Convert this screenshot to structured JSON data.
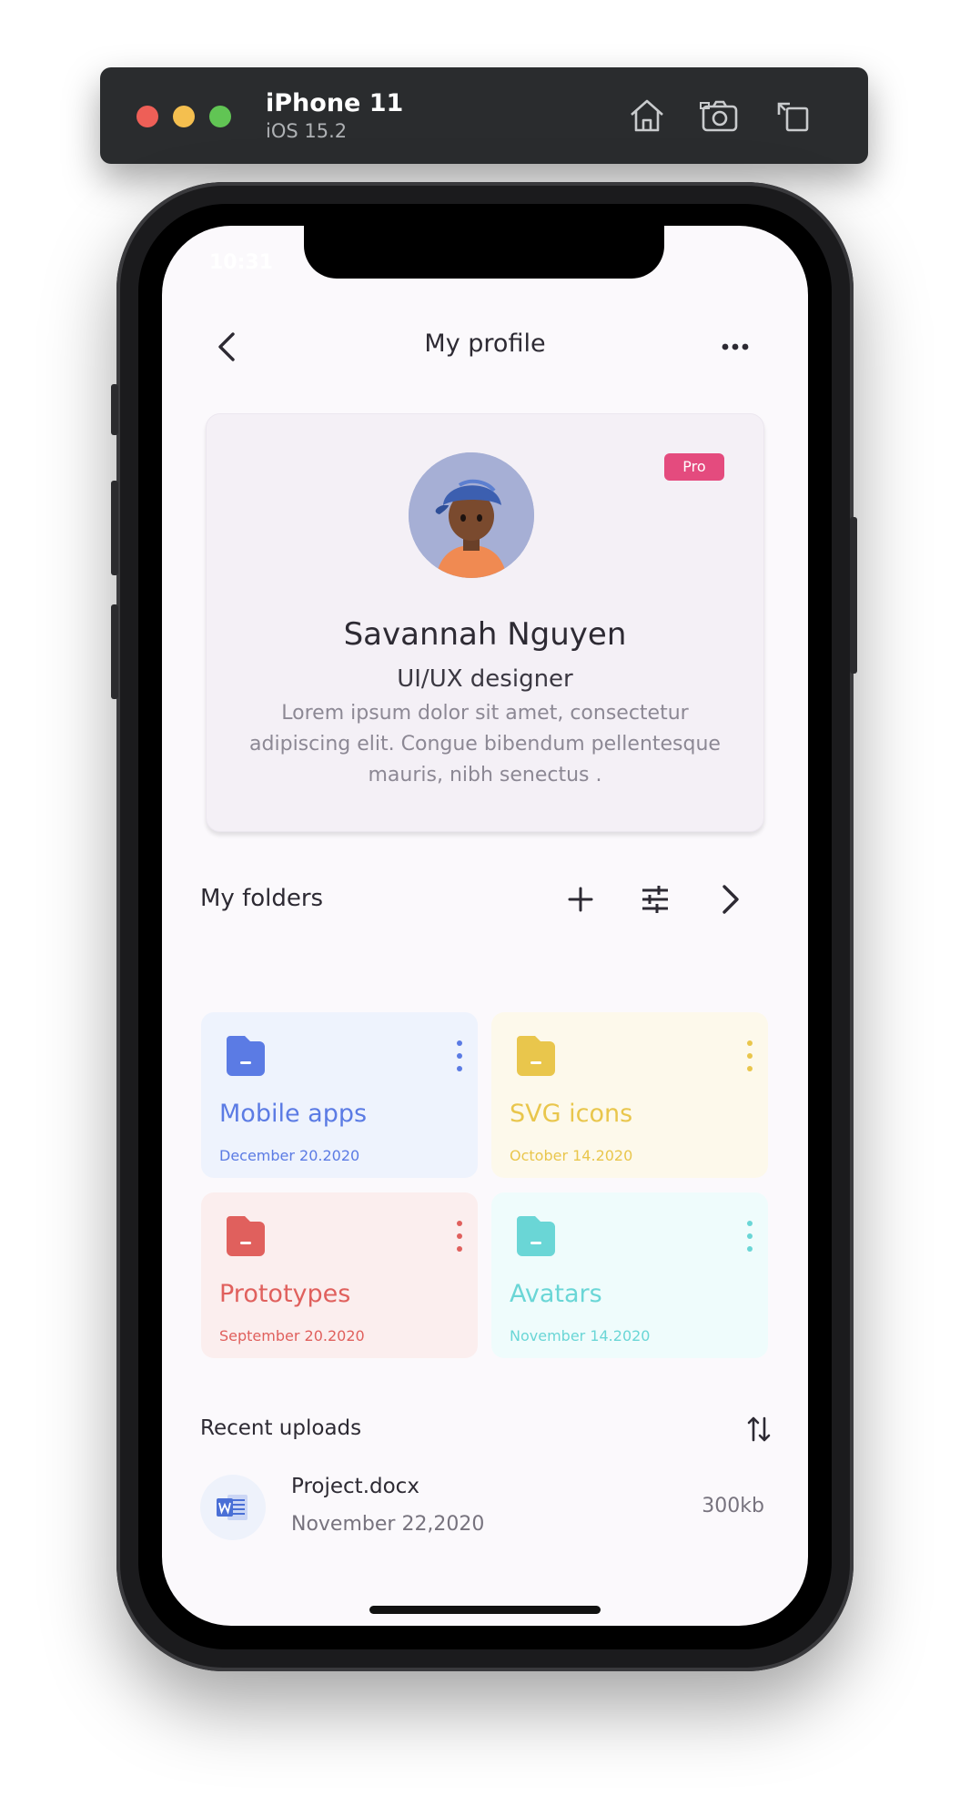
{
  "simulator": {
    "device_name": "iPhone 11",
    "os_version": "iOS 15.2",
    "buttons": {
      "home": "home-icon",
      "screenshot": "camera-icon",
      "rotate": "rotate-icon"
    }
  },
  "status_bar": {
    "time": "10:31"
  },
  "header": {
    "title": "My profile"
  },
  "profile": {
    "badge": "Pro",
    "name": "Savannah Nguyen",
    "role": "UI/UX designer",
    "bio": "Lorem ipsum dolor sit amet, consectetur adipiscing elit. Congue bibendum pellentesque mauris, nibh senectus ."
  },
  "folders_section": {
    "title": "My folders",
    "actions": [
      "plus-icon",
      "sliders-icon",
      "chevron-right-icon"
    ]
  },
  "folders": [
    {
      "name": "Mobile apps",
      "date": "December 20.2020",
      "color": "#5b7be4",
      "bg": "#eef3fd"
    },
    {
      "name": "SVG icons",
      "date": "October 14.2020",
      "color": "#e9c64c",
      "bg": "#fdf9eb"
    },
    {
      "name": "Prototypes",
      "date": "September 20.2020",
      "color": "#e0605d",
      "bg": "#fbeeee"
    },
    {
      "name": "Avatars",
      "date": "November 14.2020",
      "color": "#6ad6d6",
      "bg": "#effcfc"
    }
  ],
  "recent": {
    "title": "Recent uploads",
    "sort_icon": "sort-icon",
    "files": [
      {
        "name": "Project.docx",
        "date": "November 22,2020",
        "size": "300kb",
        "icon": "word-doc-icon"
      }
    ]
  },
  "colors": {
    "accent_pink": "#e44b7e",
    "background": "#fbf9fc",
    "card": "#f4f0f6"
  }
}
